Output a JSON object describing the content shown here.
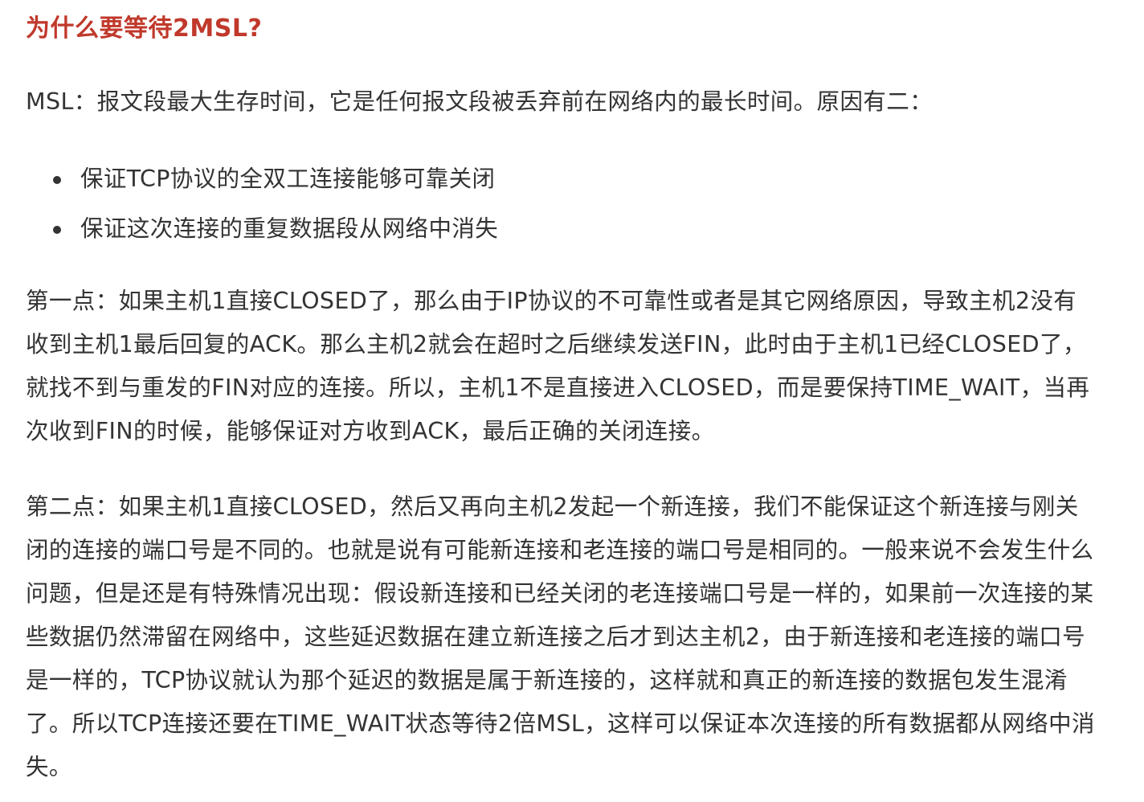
{
  "heading": "为什么要等待2MSL?",
  "intro": "MSL：报文段最大生存时间，它是任何报文段被丢弃前在网络内的最长时间。原因有二：",
  "bullets": [
    "保证TCP协议的全双工连接能够可靠关闭",
    "保证这次连接的重复数据段从网络中消失"
  ],
  "paragraph_1": "第一点：如果主机1直接CLOSED了，那么由于IP协议的不可靠性或者是其它网络原因，导致主机2没有收到主机1最后回复的ACK。那么主机2就会在超时之后继续发送FIN，此时由于主机1已经CLOSED了，就找不到与重发的FIN对应的连接。所以，主机1不是直接进入CLOSED，而是要保持TIME_WAIT，当再次收到FIN的时候，能够保证对方收到ACK，最后正确的关闭连接。",
  "paragraph_2": "第二点：如果主机1直接CLOSED，然后又再向主机2发起一个新连接，我们不能保证这个新连接与刚关闭的连接的端口号是不同的。也就是说有可能新连接和老连接的端口号是相同的。一般来说不会发生什么问题，但是还是有特殊情况出现：假设新连接和已经关闭的老连接端口号是一样的，如果前一次连接的某些数据仍然滞留在网络中，这些延迟数据在建立新连接之后才到达主机2，由于新连接和老连接的端口号是一样的，TCP协议就认为那个延迟的数据是属于新连接的，这样就和真正的新连接的数据包发生混淆了。所以TCP连接还要在TIME_WAIT状态等待2倍MSL，这样可以保证本次连接的所有数据都从网络中消失。",
  "colors": {
    "heading": "#c0392b",
    "text": "#333333",
    "background": "#ffffff"
  }
}
